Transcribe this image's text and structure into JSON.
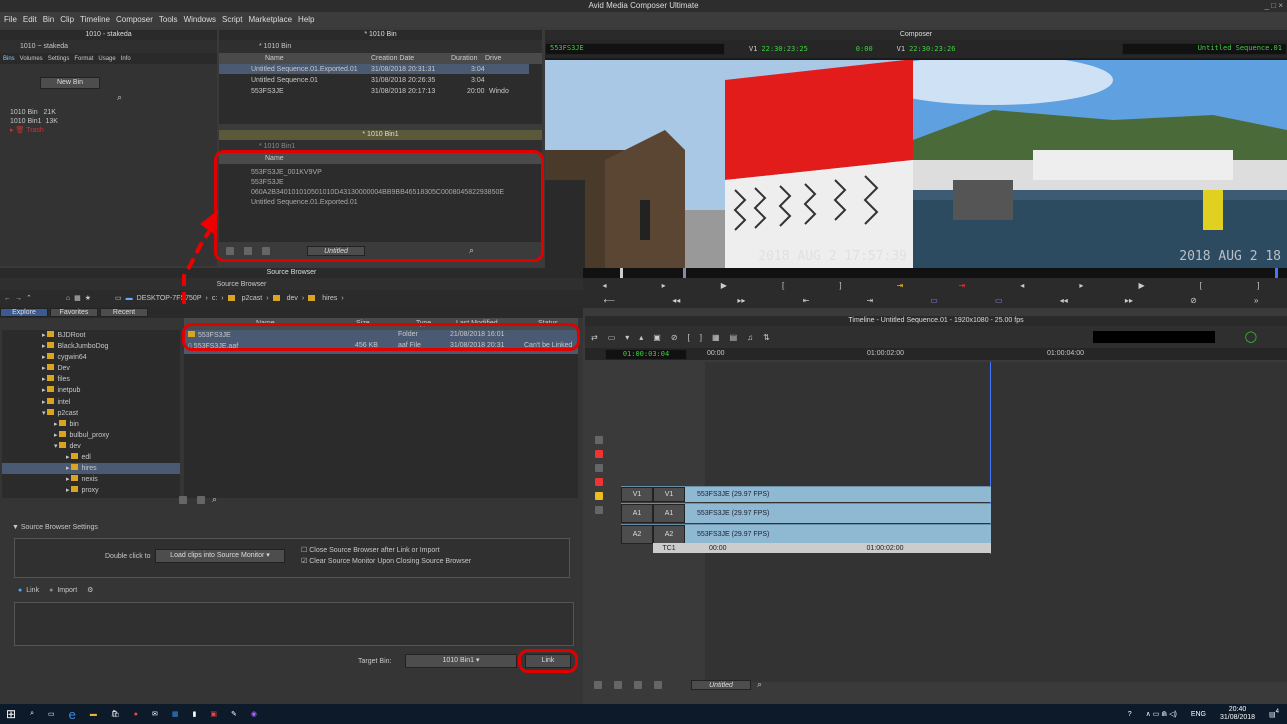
{
  "app_title": "Avid Media Composer Ultimate",
  "menu": [
    "File",
    "Edit",
    "Bin",
    "Clip",
    "Timeline",
    "Composer",
    "Tools",
    "Windows",
    "Script",
    "Marketplace",
    "Help"
  ],
  "project": {
    "title": "1010 - stakeda",
    "tab": "1010 ~ stakeda",
    "tabs": [
      "Bins",
      "Volumes",
      "Settings",
      "Format",
      "Usage",
      "Info"
    ],
    "new_bin": "New Bin",
    "bins": [
      {
        "name": "1010 Bin",
        "size": "21K"
      },
      {
        "name": "1010 Bin1",
        "size": "13K"
      }
    ],
    "trash": "Trash"
  },
  "bin1": {
    "title": "* 1010 Bin",
    "tab": "* 1010 Bin",
    "cols": [
      "Name",
      "Creation Date",
      "Duration",
      "Drive"
    ],
    "rows": [
      {
        "name": "Untitled Sequence.01.Exported.01",
        "date": "31/08/2018 20:31:31",
        "dur": "3:04",
        "drive": ""
      },
      {
        "name": "Untitled Sequence.01",
        "date": "31/08/2018 20:26:35",
        "dur": "3:04",
        "drive": ""
      },
      {
        "name": "553FS3JE",
        "date": "31/08/2018 20:17:13",
        "dur": "20:00",
        "drive": "Windo"
      }
    ]
  },
  "bin2": {
    "title": "* 1010 Bin1",
    "tab": "* 1010 Bin1",
    "col": "Name",
    "rows": [
      "553FS3JE_001KV9VP",
      "553FS3JE",
      "060A2B340101010501010D43130000004BB9BB46518305C000804582293850E",
      "Untitled Sequence.01.Exported.01"
    ],
    "view": "Untitled"
  },
  "composer": {
    "title": "Composer",
    "src_clip": "553FS3JE",
    "v1": "V1",
    "src_tc": "22:30:23:25",
    "dur_tc": "0:00",
    "rec_v1": "V1",
    "rec_tc": "22:30:23:26",
    "sequence": "Untitled Sequence.01",
    "src_stamp": "2018 AUG 2 17:57:39",
    "rec_stamp": "2018 AUG 2 18"
  },
  "source_browser": {
    "title": "Source Browser",
    "tab": "Source Browser",
    "path": [
      "DESKTOP-7FS750P",
      "c:",
      "p2cast",
      "dev",
      "hires"
    ],
    "nav_tabs": [
      "Explore",
      "Favorites",
      "Recent"
    ],
    "tree": [
      "BJDRoot",
      "BlackJumboDog",
      "cygwin64",
      "Dev",
      "files",
      "inetpub",
      "intel",
      "p2cast",
      "bin",
      "bulbul_proxy",
      "dev",
      "edl",
      "hires",
      "nexis",
      "proxy"
    ],
    "cols": [
      "Name",
      "Size",
      "Type",
      "Last Modified",
      "Status"
    ],
    "files": [
      {
        "name": "553FS3JE",
        "size": "",
        "type": "Folder",
        "mod": "21/08/2018 16:01",
        "status": ""
      },
      {
        "name": "553FS3JE.aaf",
        "size": "456 KB",
        "type": "aaf File",
        "mod": "31/08/2018 20:31",
        "status": "Can't be Linked"
      }
    ],
    "settings_label": "Source Browser Settings",
    "dbl_label": "Double click to",
    "dbl_value": "Load clips into Source Monitor",
    "opt1": "Close Source Browser after Link or Import",
    "opt2": "Clear Source Monitor Upon Closing Source Browser",
    "link": "Link",
    "import": "Import",
    "target_label": "Target Bin:",
    "target_value": "1010 Bin1",
    "link_btn": "Link"
  },
  "timeline": {
    "title": "Timeline - Untitled Sequence.01 - 1920x1080 - 25.00 fps",
    "tc": "01:00:03:04",
    "ruler": [
      "00:00",
      "01:00:02:00",
      "01:00:04:00"
    ],
    "tracks": [
      {
        "src": "V1",
        "rec": "V1",
        "clip": "553FS3JE (29.97 FPS)"
      },
      {
        "src": "A1",
        "rec": "A1",
        "clip": "553FS3JE (29.97 FPS)"
      },
      {
        "src": "A2",
        "rec": "A2",
        "clip": "553FS3JE (29.97 FPS)"
      }
    ],
    "tc1": "TC1",
    "tc_ruler": [
      "00:00",
      "01:00:02:00"
    ],
    "bottom_view": "Untitled"
  },
  "taskbar": {
    "lang": "ENG",
    "time": "20:40",
    "date": "31/08/2018",
    "badge": "4"
  },
  "colors": {
    "accent_red": "#e00000",
    "clip_blue": "#7fb3cc",
    "timecode_green": "#3fd03f",
    "selected_row": "#4a5a72"
  }
}
